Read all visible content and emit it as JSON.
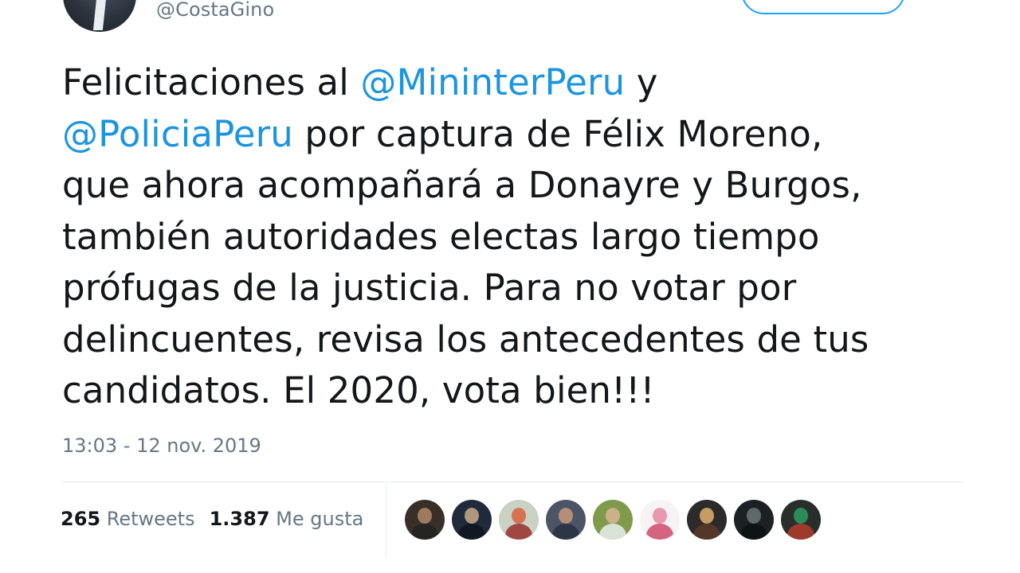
{
  "header": {
    "handle": "@CostaGino"
  },
  "tweet": {
    "lines": [
      [
        {
          "text": "Felicitaciones al ",
          "type": "text"
        },
        {
          "text": "@MininterPeru",
          "type": "mention"
        },
        {
          "text": " y",
          "type": "text"
        }
      ],
      [
        {
          "text": "@PoliciaPeru",
          "type": "mention"
        },
        {
          "text": " por captura de Félix Moreno,",
          "type": "text"
        }
      ],
      [
        {
          "text": "que ahora acompañará a Donayre y Burgos,",
          "type": "text"
        }
      ],
      [
        {
          "text": "también autoridades electas largo tiempo",
          "type": "text"
        }
      ],
      [
        {
          "text": "prófugas de la justicia. Para no votar por",
          "type": "text"
        }
      ],
      [
        {
          "text": "delincuentes, revisa los antecedentes de tus",
          "type": "text"
        }
      ],
      [
        {
          "text": "candidatos. El 2020, vota bien!!!",
          "type": "text"
        }
      ]
    ],
    "timestamp": "13:03 - 12 nov. 2019"
  },
  "stats": {
    "retweets_count": "265",
    "retweets_label": "Retweets",
    "likes_count": "1.387",
    "likes_label": "Me gusta"
  },
  "colors": {
    "mention": "#1b95e0",
    "text": "#14171a",
    "muted": "#657786",
    "accent": "#1da1f2"
  },
  "likers": [
    {
      "name": "liker-avatar-1",
      "bg": "#3a2f28",
      "face": "#b08866",
      "body": "#222222"
    },
    {
      "name": "liker-avatar-2",
      "bg": "#1f2a3a",
      "face": "#c9a98c",
      "body": "#0f1520"
    },
    {
      "name": "liker-avatar-3",
      "bg": "#c9d2c4",
      "face": "#d8603e",
      "body": "#9a2f2a"
    },
    {
      "name": "liker-avatar-4",
      "bg": "#4b5566",
      "face": "#c69a7a",
      "body": "#283142"
    },
    {
      "name": "liker-avatar-5",
      "bg": "#7e9a4a",
      "face": "#d8b497",
      "body": "#e8eef0"
    },
    {
      "name": "liker-avatar-6",
      "bg": "#f7f2f4",
      "face": "#e58aa0",
      "body": "#d04a6a"
    },
    {
      "name": "liker-avatar-7",
      "bg": "#2c2a2a",
      "face": "#e0b070",
      "body": "#5b3a28"
    },
    {
      "name": "liker-avatar-8",
      "bg": "#1c2224",
      "face": "#6a7774",
      "body": "#0c1010"
    },
    {
      "name": "liker-avatar-9",
      "bg": "#2a2e2a",
      "face": "#2f9b60",
      "body": "#b33c2c"
    }
  ]
}
